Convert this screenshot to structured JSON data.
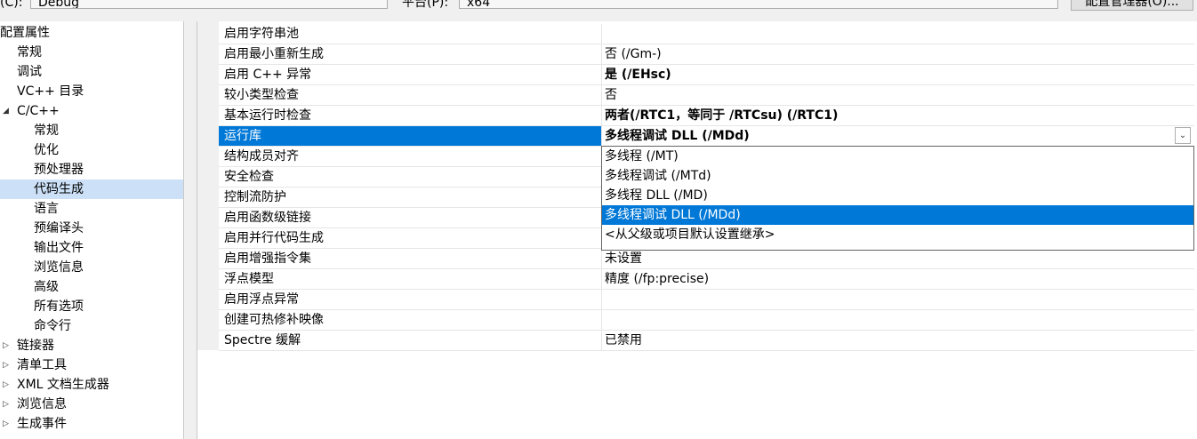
{
  "toolbar": {
    "config_label": "(C):",
    "config_value": "Debug",
    "platform_label": "平台(P):",
    "platform_value": "x64",
    "config_manager_label": "配置管理器(O)..."
  },
  "tree": {
    "items": [
      {
        "label": "配置属性",
        "level": 0,
        "arrow": ""
      },
      {
        "label": "常规",
        "level": 1,
        "arrow": ""
      },
      {
        "label": "调试",
        "level": 1,
        "arrow": ""
      },
      {
        "label": "VC++ 目录",
        "level": 1,
        "arrow": ""
      },
      {
        "label": "C/C++",
        "level": 1,
        "arrow": "◢"
      },
      {
        "label": "常规",
        "level": 2,
        "arrow": ""
      },
      {
        "label": "优化",
        "level": 2,
        "arrow": ""
      },
      {
        "label": "预处理器",
        "level": 2,
        "arrow": ""
      },
      {
        "label": "代码生成",
        "level": 2,
        "arrow": "",
        "selected": true
      },
      {
        "label": "语言",
        "level": 2,
        "arrow": ""
      },
      {
        "label": "预编译头",
        "level": 2,
        "arrow": ""
      },
      {
        "label": "输出文件",
        "level": 2,
        "arrow": ""
      },
      {
        "label": "浏览信息",
        "level": 2,
        "arrow": ""
      },
      {
        "label": "高级",
        "level": 2,
        "arrow": ""
      },
      {
        "label": "所有选项",
        "level": 2,
        "arrow": ""
      },
      {
        "label": "命令行",
        "level": 2,
        "arrow": ""
      },
      {
        "label": "链接器",
        "level": 1,
        "arrow": "▷"
      },
      {
        "label": "清单工具",
        "level": 1,
        "arrow": "▷"
      },
      {
        "label": "XML 文档生成器",
        "level": 1,
        "arrow": "▷"
      },
      {
        "label": "浏览信息",
        "level": 1,
        "arrow": "▷"
      },
      {
        "label": "生成事件",
        "level": 1,
        "arrow": "▷"
      }
    ]
  },
  "properties": {
    "rows": [
      {
        "name": "启用字符串池",
        "value": "",
        "bold": false
      },
      {
        "name": "启用最小重新生成",
        "value": "否 (/Gm-)",
        "bold": false
      },
      {
        "name": "启用 C++ 异常",
        "value": "是 (/EHsc)",
        "bold": true
      },
      {
        "name": "较小类型检查",
        "value": "否",
        "bold": false
      },
      {
        "name": "基本运行时检查",
        "value": "两者(/RTC1，等同于 /RTCsu) (/RTC1)",
        "bold": true
      },
      {
        "name": "运行库",
        "value": "多线程调试 DLL (/MDd)",
        "bold": true,
        "selected": true
      },
      {
        "name": "结构成员对齐",
        "value": "",
        "bold": false
      },
      {
        "name": "安全检查",
        "value": "",
        "bold": false
      },
      {
        "name": "控制流防护",
        "value": "",
        "bold": false
      },
      {
        "name": "启用函数级链接",
        "value": "",
        "bold": false
      },
      {
        "name": "启用并行代码生成",
        "value": "",
        "bold": false
      },
      {
        "name": "启用增强指令集",
        "value": "未设置",
        "bold": false
      },
      {
        "name": "浮点模型",
        "value": "精度 (/fp:precise)",
        "bold": false
      },
      {
        "name": "启用浮点异常",
        "value": "",
        "bold": false
      },
      {
        "name": "创建可热修补映像",
        "value": "",
        "bold": false
      },
      {
        "name": "Spectre 缓解",
        "value": "已禁用",
        "bold": false
      }
    ]
  },
  "dropdown": {
    "options": [
      {
        "label": "多线程 (/MT)"
      },
      {
        "label": "多线程调试 (/MTd)"
      },
      {
        "label": "多线程 DLL (/MD)"
      },
      {
        "label": "多线程调试 DLL (/MDd)",
        "selected": true
      },
      {
        "label": "<从父级或项目默认设置继承>"
      }
    ]
  },
  "colors": {
    "selection": "#0078d7",
    "tree_selection": "#cce0f7"
  },
  "icons": {
    "dropdown": "chevron-down-icon",
    "expanded": "expanded-triangle-icon",
    "collapsed": "collapsed-triangle-icon"
  }
}
